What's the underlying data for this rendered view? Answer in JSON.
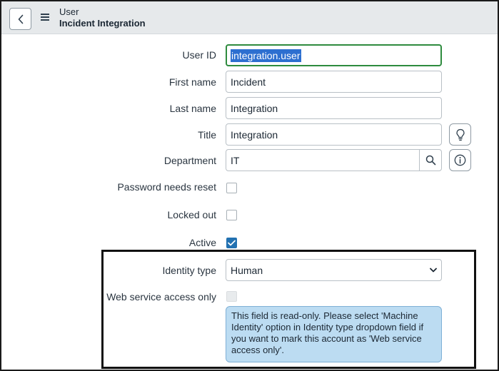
{
  "header": {
    "table_name": "User",
    "record_name": "Incident Integration",
    "back_icon": "chevron-left-icon",
    "menu_icon": "hamburger-menu-icon"
  },
  "form": {
    "user_id": {
      "label": "User ID",
      "value": "integration.user"
    },
    "first_name": {
      "label": "First name",
      "value": "Incident"
    },
    "last_name": {
      "label": "Last name",
      "value": "Integration"
    },
    "title": {
      "label": "Title",
      "value": "Integration",
      "suggest_icon": "lightbulb-icon"
    },
    "department": {
      "label": "Department",
      "value": "IT",
      "lookup_icon": "search-icon",
      "info_icon": "info-icon"
    },
    "password_needs_reset": {
      "label": "Password needs reset",
      "checked": false
    },
    "locked_out": {
      "label": "Locked out",
      "checked": false
    },
    "active": {
      "label": "Active",
      "checked": true
    },
    "identity_type": {
      "label": "Identity type",
      "value": "Human"
    },
    "web_service_access_only": {
      "label": "Web service access only",
      "checked": false,
      "disabled": true,
      "message": "This field is read-only. Please select 'Machine Identity' option in Identity type dropdown field if you want to mark this account as 'Web service access only'."
    }
  },
  "colors": {
    "focus_border": "#2e8b3e",
    "selection": "#2d6fd0",
    "checkbox_checked": "#2271b1",
    "info_background": "#bcdcf2",
    "header_background": "#e6e9eb"
  }
}
